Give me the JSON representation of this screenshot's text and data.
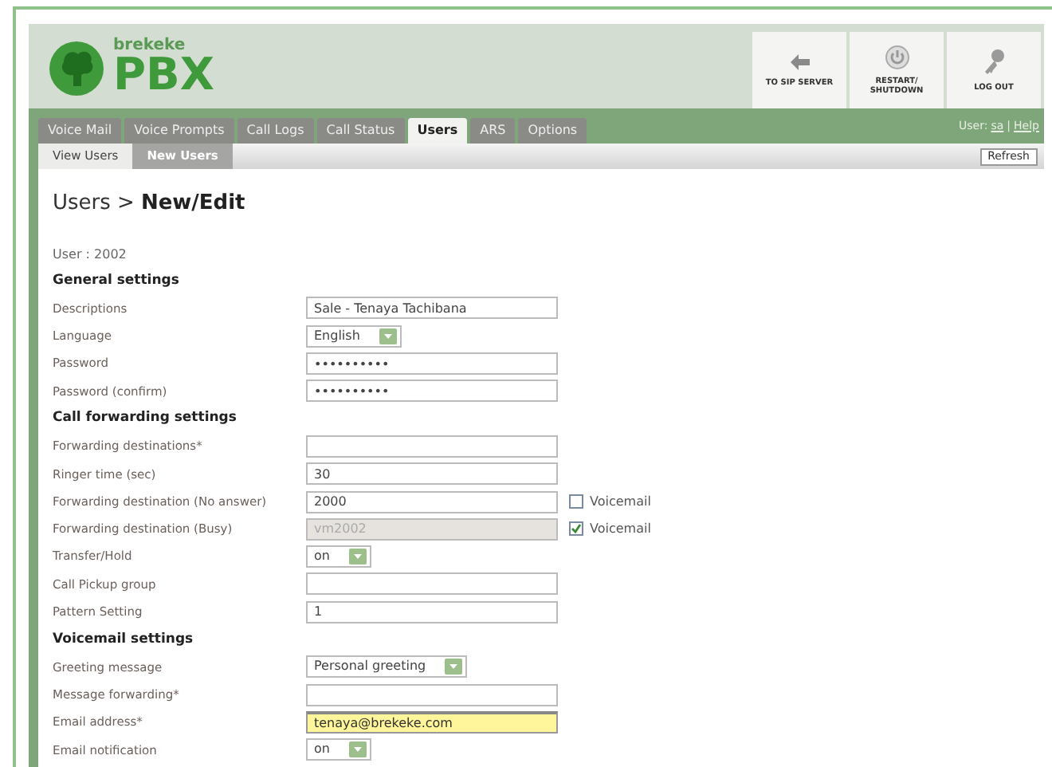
{
  "logo": {
    "small": "brekeke",
    "big": "PBX"
  },
  "header_buttons": [
    {
      "kind": "server",
      "label": "TO SIP SERVER"
    },
    {
      "kind": "power",
      "label": "RESTART/ SHUTDOWN"
    },
    {
      "kind": "key",
      "label": "LOG OUT"
    }
  ],
  "tabs": [
    {
      "label": "Voice Mail",
      "selected": false
    },
    {
      "label": "Voice Prompts",
      "selected": false
    },
    {
      "label": "Call Logs",
      "selected": false
    },
    {
      "label": "Call Status",
      "selected": false
    },
    {
      "label": "Users",
      "selected": true
    },
    {
      "label": "ARS",
      "selected": false
    },
    {
      "label": "Options",
      "selected": false
    }
  ],
  "user_info": {
    "prefix": "User:",
    "user": "sa",
    "separator": "|",
    "help": "Help"
  },
  "subtabs": [
    {
      "label": "View Users",
      "selected": false
    },
    {
      "label": "New Users",
      "selected": true
    }
  ],
  "refresh": "Refresh",
  "heading": {
    "path": "Users >",
    "current": "New/Edit"
  },
  "user_line": "User : 2002",
  "rows": [
    {
      "kind": "section",
      "label": "General settings"
    },
    {
      "kind": "field",
      "label": "Descriptions",
      "input": {
        "kind": "text",
        "value": "Sale - Tenaya Tachibana"
      }
    },
    {
      "kind": "field",
      "label": "Language",
      "input": {
        "kind": "select",
        "value": "English"
      }
    },
    {
      "kind": "field",
      "label": "Password",
      "input": {
        "kind": "text",
        "value": "••••••••••"
      }
    },
    {
      "kind": "field",
      "label": "Password (confirm)",
      "input": {
        "kind": "text",
        "value": "••••••••••"
      }
    },
    {
      "kind": "section",
      "label": "Call forwarding settings"
    },
    {
      "kind": "field",
      "label": "Forwarding destinations*",
      "input": {
        "kind": "text"
      }
    },
    {
      "kind": "field",
      "label": "Ringer time (sec)",
      "input": {
        "kind": "text",
        "value": "30"
      }
    },
    {
      "kind": "field",
      "label": "Forwarding destination (No answer)",
      "input": {
        "kind": "text",
        "value": "2000"
      },
      "checkbox": {
        "label": "Voicemail",
        "checked": false
      }
    },
    {
      "kind": "field",
      "label": "Forwarding destination (Busy)",
      "input": {
        "kind": "text",
        "value": "vm2002",
        "disabled": true
      },
      "checkbox": {
        "label": "Voicemail",
        "checked": true
      }
    },
    {
      "kind": "field",
      "label": "Transfer/Hold",
      "input": {
        "kind": "select",
        "value": "on"
      }
    },
    {
      "kind": "field",
      "label": "Call Pickup group",
      "input": {
        "kind": "text"
      }
    },
    {
      "kind": "field",
      "label": "Pattern Setting",
      "input": {
        "kind": "text",
        "value": "1"
      }
    },
    {
      "kind": "section",
      "label": "Voicemail settings"
    },
    {
      "kind": "field",
      "label": "Greeting message",
      "input": {
        "kind": "select",
        "value": "Personal greeting"
      }
    },
    {
      "kind": "field",
      "label": "Message forwarding*",
      "input": {
        "kind": "text"
      }
    },
    {
      "kind": "field",
      "label": "Email address*",
      "input": {
        "kind": "text",
        "value": "tenaya@brekeke.com",
        "focused": true
      }
    },
    {
      "kind": "field",
      "label": "Email notification",
      "input": {
        "kind": "select",
        "value": "on"
      }
    }
  ]
}
